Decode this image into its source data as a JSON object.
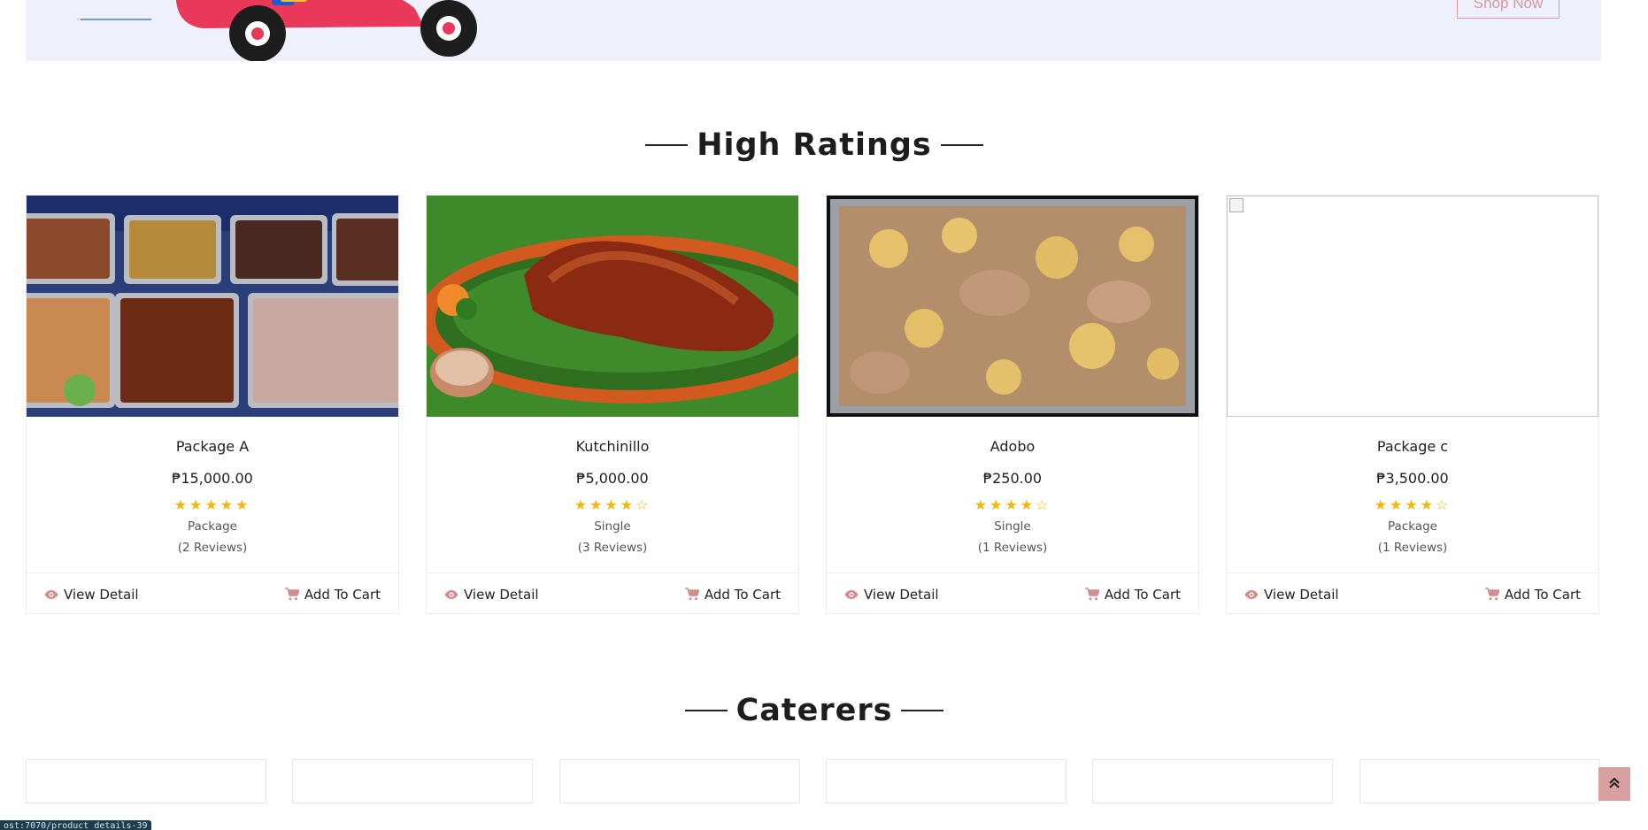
{
  "banner": {
    "shop_now_label": "Shop Now",
    "background": "#eef0fc"
  },
  "high_ratings": {
    "title": "High Ratings",
    "products": [
      {
        "name": "Package A",
        "price": "₱15,000.00",
        "rating": 5,
        "stars": "★★★★★",
        "category": "Package",
        "reviews": "(2 Reviews)",
        "image": "catering-trays",
        "view_label": "View Detail",
        "cart_label": "Add To Cart"
      },
      {
        "name": "Kutchinillo",
        "price": "₱5,000.00",
        "rating": 4,
        "stars": "★★★★☆",
        "category": "Single",
        "reviews": "(3 Reviews)",
        "image": "roast-pig",
        "view_label": "View Detail",
        "cart_label": "Add To Cart"
      },
      {
        "name": "Adobo",
        "price": "₱250.00",
        "rating": 4,
        "stars": "★★★★☆",
        "category": "Single",
        "reviews": "(1 Reviews)",
        "image": "adobo-tray",
        "view_label": "View Detail",
        "cart_label": "Add To Cart"
      },
      {
        "name": "Package c",
        "price": "₱3,500.00",
        "rating": 4,
        "stars": "★★★★☆",
        "category": "Package",
        "reviews": "(1 Reviews)",
        "image": "broken-image",
        "view_label": "View Detail",
        "cart_label": "Add To Cart"
      }
    ]
  },
  "caterers": {
    "title": "Caterers",
    "count": 6
  },
  "status_bar": {
    "url": "ost:7070/product_details-39"
  },
  "colors": {
    "accent": "#d08e8e",
    "star": "#f5b800",
    "scroll_top_bg": "#d9a0a0"
  },
  "icons": {
    "view": "eye-icon",
    "cart": "cart-icon",
    "scroll_top": "double-chevron-up-icon"
  }
}
